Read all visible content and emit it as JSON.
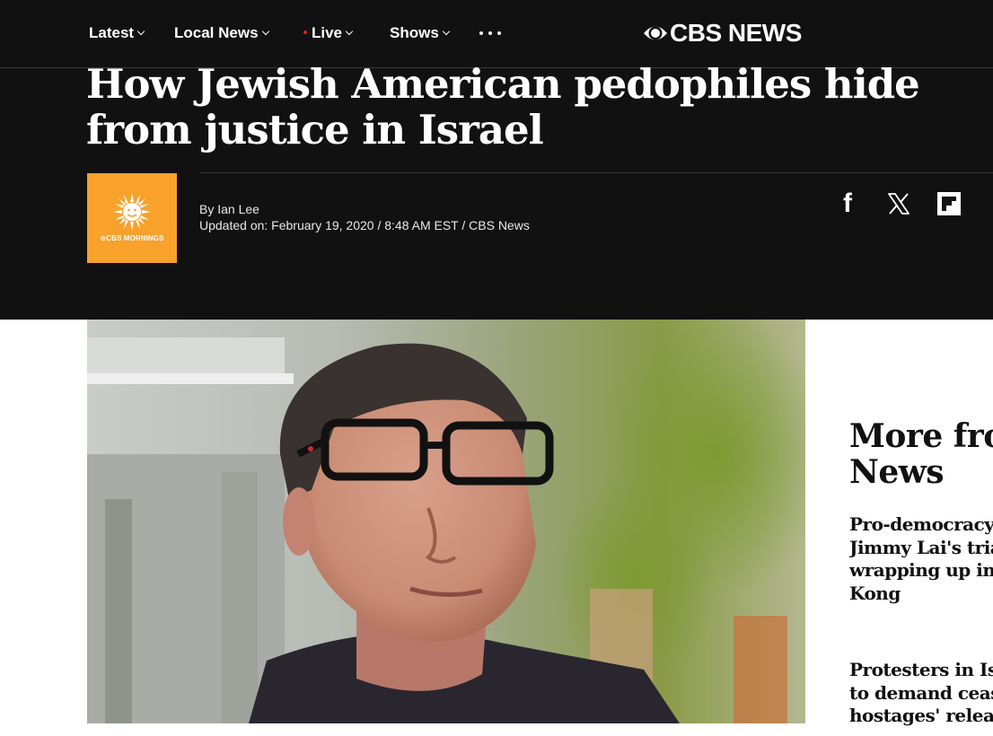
{
  "nav": {
    "items": [
      {
        "label": "Latest",
        "has_dropdown": true
      },
      {
        "label": "Local News",
        "has_dropdown": true
      },
      {
        "label": "Live",
        "has_dropdown": true,
        "live_dot_color": "#e2231a"
      },
      {
        "label": "Shows",
        "has_dropdown": true
      }
    ],
    "more_icon": "more-horizontal-icon",
    "brand": {
      "logo_icon": "cbs-eye-icon",
      "text": "CBS NEWS"
    }
  },
  "article": {
    "headline_line1": "How Jewish American pedophiles hide",
    "headline_line2": "from justice in Israel",
    "show_logo": {
      "text": "⊙CBS MORNINGS",
      "icon": "sun-icon",
      "color": "#f8a12b"
    },
    "byline": "By Ian Lee",
    "updated": "Updated on: February 19, 2020 / 8:48 AM EST / CBS News",
    "share_icons": [
      "facebook-icon",
      "x-icon",
      "flipboard-icon"
    ]
  },
  "sidebar": {
    "title_line1": "More fro",
    "title_line2": "News",
    "stories": [
      {
        "lines": [
          "Pro-democracy a",
          "Jimmy Lai's trial",
          "wrapping up in H",
          "Kong"
        ]
      },
      {
        "lines": [
          "Protesters in Isra",
          "to demand cease",
          "hostages' release"
        ]
      }
    ]
  },
  "colors": {
    "header_bg": "#111111",
    "accent_orange": "#f8a12b",
    "live_red": "#e2231a"
  }
}
